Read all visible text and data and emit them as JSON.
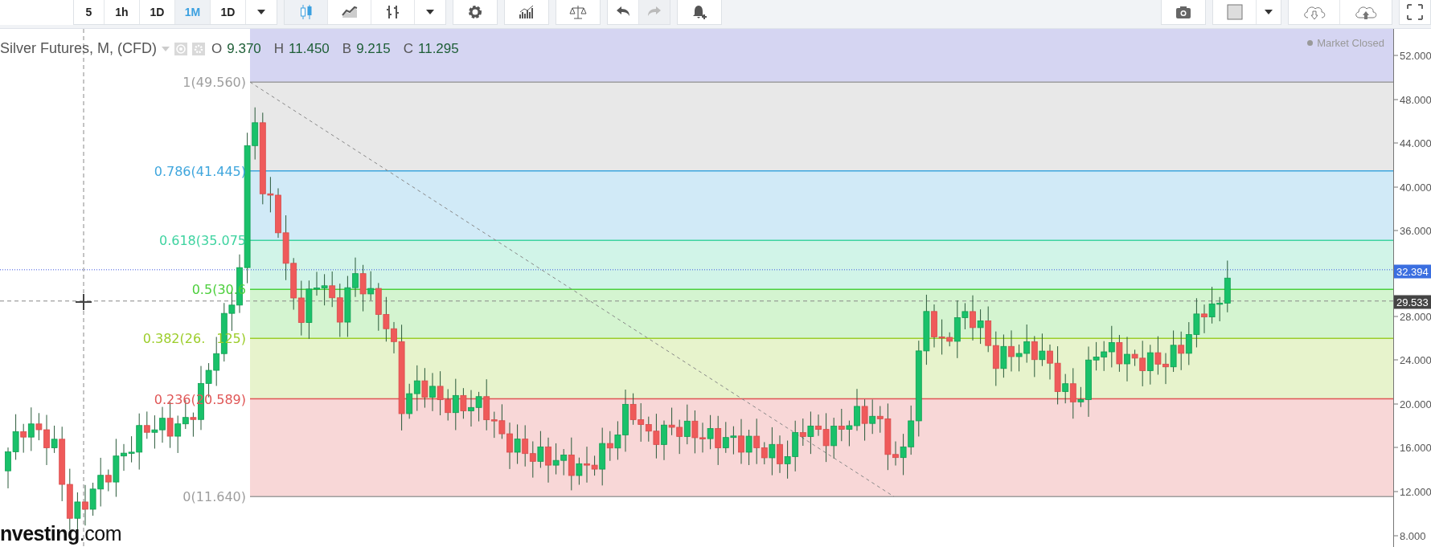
{
  "toolbar": {
    "intervals": [
      {
        "label": "5",
        "selected": false
      },
      {
        "label": "1h",
        "selected": false
      },
      {
        "label": "1D",
        "selected": false
      },
      {
        "label": "1M",
        "selected": true
      },
      {
        "label": "1D",
        "selected": false
      }
    ],
    "chart_types": [
      {
        "kind": "candles",
        "selected": true
      },
      {
        "kind": "area",
        "selected": false
      },
      {
        "kind": "bars",
        "selected": false
      }
    ],
    "history": [
      {
        "kind": "undo",
        "disabled": false
      },
      {
        "kind": "redo",
        "disabled": true
      }
    ]
  },
  "legend": {
    "title": "Silver Futures, M, (CFD)",
    "values": [
      {
        "key": "O",
        "value": "9.370"
      },
      {
        "key": "H",
        "value": "11.450"
      },
      {
        "key": "B",
        "value": "9.215"
      },
      {
        "key": "C",
        "value": "11.295"
      }
    ]
  },
  "market_status": "Market Closed",
  "fibonacci": [
    {
      "label": "1(49.560)",
      "color": "#9e9e9e"
    },
    {
      "label": "0.786(41.445)",
      "color": "#3fa6dd"
    },
    {
      "label": "0.618(35.075",
      "color": "#3ed3a0"
    },
    {
      "label": "0.5(30.6",
      "color": "#4ccf3c"
    },
    {
      "label": "0.382(26.",
      "tail": "125)",
      "color": "#9ccd2a"
    },
    {
      "label": "0.236(20.589)",
      "color": "#e05656"
    },
    {
      "label": "0(11.640)",
      "color": "#9e9e9e"
    }
  ],
  "price_axis": [
    "52.000",
    "48.000",
    "44.000",
    "40.000",
    "36.000",
    "32.394",
    "29.533",
    "28.000",
    "24.000",
    "20.000",
    "16.000",
    "12.000",
    "8.000"
  ],
  "logo": "**nvesting**.com"
}
